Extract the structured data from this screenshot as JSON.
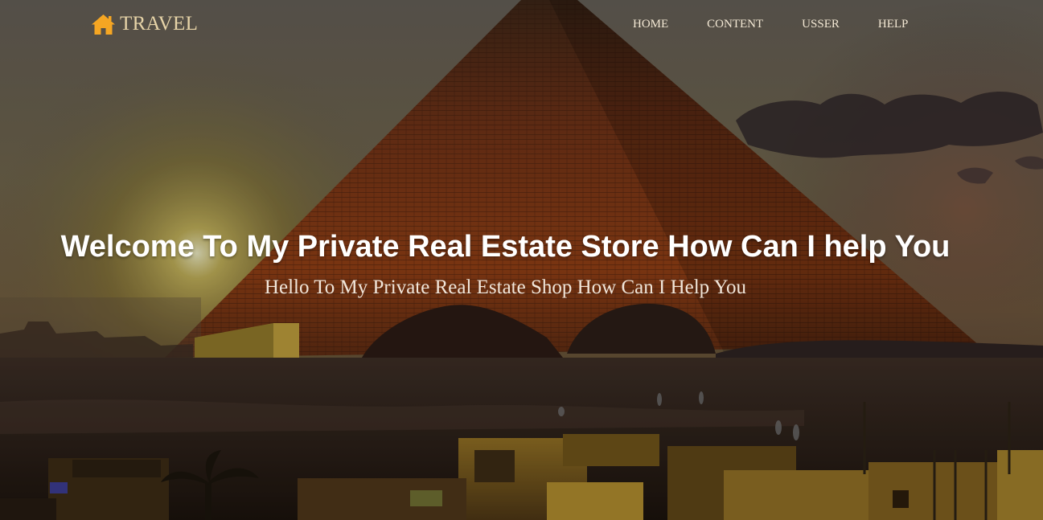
{
  "brand": {
    "name": "TRAVEL",
    "icon": "home-icon",
    "icon_color": "#f5a623"
  },
  "nav": {
    "items": [
      {
        "label": "HOME"
      },
      {
        "label": "CONTENT"
      },
      {
        "label": "USSER"
      },
      {
        "label": "HELP"
      }
    ]
  },
  "hero": {
    "title": "Welcome To My Private Real Estate Store How Can I help You",
    "subtitle": "Hello To My Private Real Estate Shop How Can I Help You",
    "background": "pyramid-sunset-photo"
  }
}
